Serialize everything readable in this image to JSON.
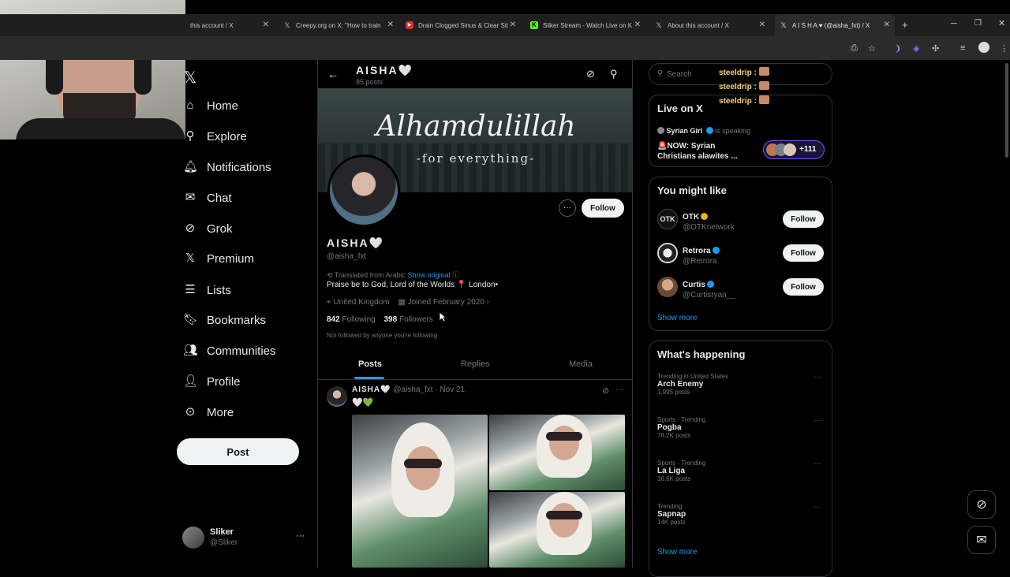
{
  "browser": {
    "tabs": [
      {
        "title": "this account / X",
        "icon": "x-logo"
      },
      {
        "title": "Creepy.org on X: \"How to train",
        "icon": "x-logo"
      },
      {
        "title": "Drain Clogged Sinus & Clear Sti",
        "icon": "youtube-logo"
      },
      {
        "title": "Sliker Stream - Watch Live on K",
        "icon": "kick-logo"
      },
      {
        "title": "About this account / X",
        "icon": "x-logo"
      },
      {
        "title": "A I S H A ♥ (@aisha_fxt) / X",
        "icon": "x-logo"
      }
    ],
    "new_tab": "+"
  },
  "nav": {
    "items": [
      {
        "label": "Home",
        "icon": "home-icon"
      },
      {
        "label": "Explore",
        "icon": "search-icon"
      },
      {
        "label": "Notifications",
        "icon": "bell-icon"
      },
      {
        "label": "Chat",
        "icon": "mail-icon"
      },
      {
        "label": "Grok",
        "icon": "grok-icon"
      },
      {
        "label": "Premium",
        "icon": "x-icon"
      },
      {
        "label": "Lists",
        "icon": "list-icon"
      },
      {
        "label": "Bookmarks",
        "icon": "bookmark-icon"
      },
      {
        "label": "Communities",
        "icon": "people-icon"
      },
      {
        "label": "Profile",
        "icon": "person-icon"
      },
      {
        "label": "More",
        "icon": "more-circle-icon"
      }
    ],
    "post_label": "Post",
    "account": {
      "name": "Sliker",
      "handle": "@Sliker"
    }
  },
  "profile": {
    "header_name": "AISHA🤍",
    "header_posts": "85 posts",
    "banner_title": "Alhamdulillah",
    "banner_subtitle": "-for everything-",
    "name": "AISHA🤍",
    "handle": "@aisha_fxt",
    "follow_label": "Follow",
    "translated_note": "Translated from Arabic",
    "show_original": "Show original",
    "bio": "Praise be to God, Lord of the Worlds 📍 London•",
    "location": "United Kingdom",
    "joined": "Joined February 2020",
    "following_count": "842",
    "following_label": "Following",
    "followers_count": "398",
    "followers_label": "Followers",
    "not_followed": "Not followed by anyone you're following"
  },
  "tabs": [
    "Posts",
    "Replies",
    "Media"
  ],
  "post": {
    "name": "AISHA🤍",
    "handle": "@aisha_fxt",
    "date": "Nov 21",
    "separator": "·",
    "text": "🤍💚"
  },
  "right": {
    "search_placeholder": "Search",
    "chat_overlay": [
      {
        "user": "steeldrip",
        "sep": ":"
      },
      {
        "user": "steeldrip",
        "sep": ":"
      },
      {
        "user": "steeldrip",
        "sep": ":"
      }
    ],
    "live": {
      "title": "Live on X",
      "host": "Syrian Girl",
      "status": "is speaking",
      "text_line1": "🚨NOW: Syrian",
      "text_line2": "Christians alawites ...",
      "listeners": "+111"
    },
    "might_like": {
      "title": "You might like",
      "accounts": [
        {
          "name": "OTK",
          "handle": "@OTKnetwork",
          "badge_color": "#e8b10c",
          "button": "Follow"
        },
        {
          "name": "Retrora",
          "handle": "@Retrora",
          "badge_color": "#1d9bf0",
          "button": "Follow"
        },
        {
          "name": "Curtis",
          "handle": "@Curtisryan__",
          "badge_color": "#1d9bf0",
          "button": "Follow"
        }
      ],
      "show_more": "Show more"
    },
    "happening": {
      "title": "What's happening",
      "trends": [
        {
          "meta": "Trending in United States",
          "name": "Arch Enemy",
          "count": "1,995 posts"
        },
        {
          "meta": "Sports · Trending",
          "name": "Pogba",
          "count": "78.2K posts"
        },
        {
          "meta": "Sports · Trending",
          "name": "La Liga",
          "count": "16.6K posts"
        },
        {
          "meta": "Trending",
          "name": "Sapnap",
          "count": "14K posts"
        }
      ],
      "show_more": "Show more"
    }
  },
  "colors": {
    "accent": "#1d9bf0",
    "background": "#000000",
    "border": "#2f3336",
    "muted": "#71767b"
  }
}
